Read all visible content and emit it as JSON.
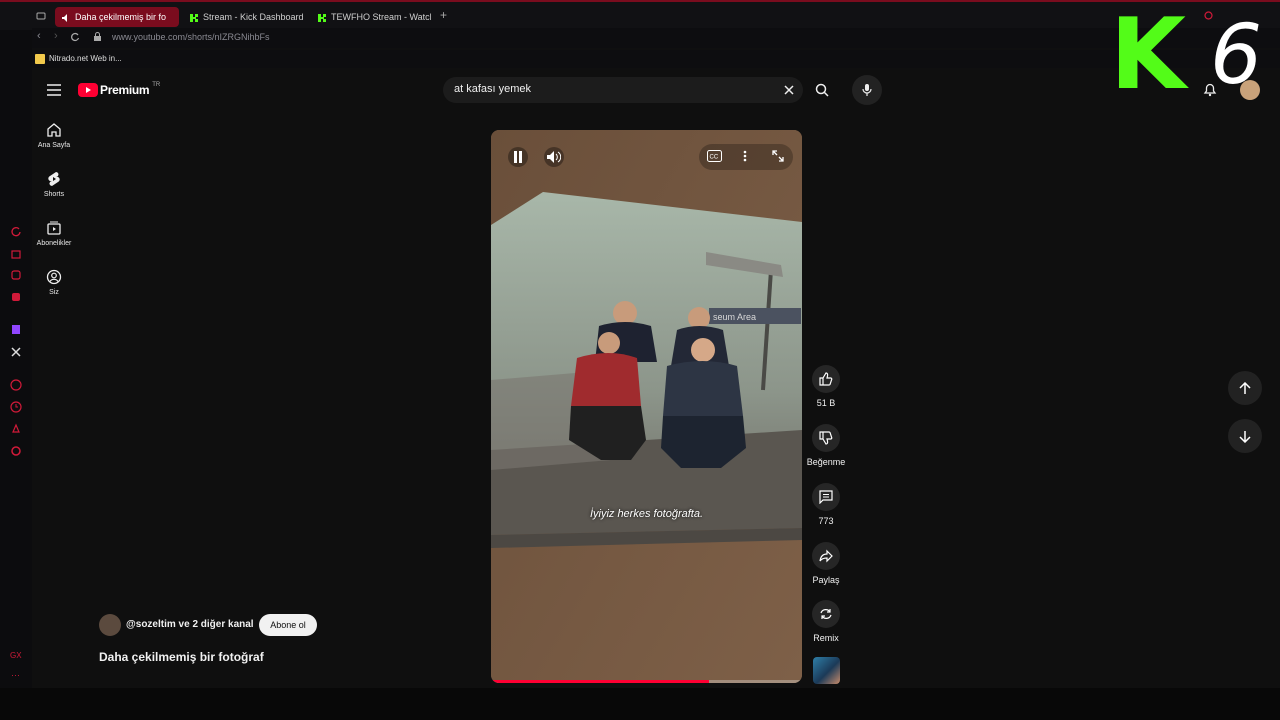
{
  "browser": {
    "tabs": [
      {
        "label": "Daha çekilmemiş bir fo",
        "active": true
      },
      {
        "label": "Stream - Kick Dashboard",
        "active": false
      },
      {
        "label": "TEWFHO Stream - Watch",
        "active": false
      }
    ],
    "url": "www.youtube.com/shorts/nIZRGNihbFs",
    "bookmark": "Nitrado.net Web in..."
  },
  "youtube": {
    "logo": "Premium",
    "region": "TR",
    "search_value": "at kafası yemek",
    "nav": [
      {
        "label": "Ana Sayfa",
        "icon": "home-icon"
      },
      {
        "label": "Shorts",
        "icon": "shorts-icon"
      },
      {
        "label": "Abonelikler",
        "icon": "subscriptions-icon"
      },
      {
        "label": "Siz",
        "icon": "user-icon"
      }
    ]
  },
  "short": {
    "caption": "İyiyiz herkes fotoğrafta.",
    "sign_text": "seum Area",
    "channel_text": "@sozeltim ve 2 diğer kanal",
    "subscribe_label": "Abone ol",
    "title": "Daha çekilmemiş bir fotoğraf",
    "progress": 0.7,
    "actions": {
      "like": "51 B",
      "dislike": "Beğenme",
      "comments": "773",
      "share": "Paylaş",
      "remix": "Remix"
    }
  },
  "overlay": {
    "k_letter": "K",
    "number": "6"
  },
  "colors": {
    "accent": "#ff0033",
    "kick_green": "#53fc18",
    "browser_red": "#7a0c1e"
  }
}
